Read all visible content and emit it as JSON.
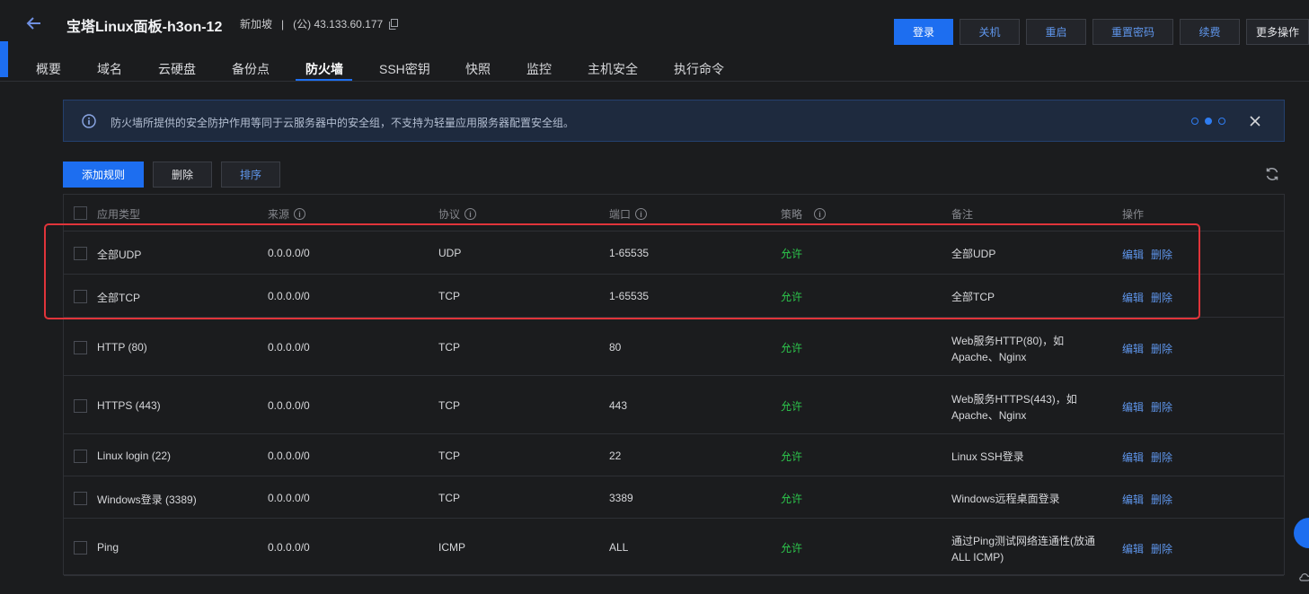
{
  "header": {
    "title": "宝塔Linux面板-h3on-12",
    "region": "新加坡",
    "separator": "|",
    "ip": "(公) 43.133.60.177",
    "buttons": {
      "login": "登录",
      "shutdown": "关机",
      "restart": "重启",
      "reset_password": "重置密码",
      "renew": "续费",
      "more": "更多操作"
    }
  },
  "tabs": [
    "概要",
    "域名",
    "云硬盘",
    "备份点",
    "防火墙",
    "SSH密钥",
    "快照",
    "监控",
    "主机安全",
    "执行命令"
  ],
  "active_tab": "防火墙",
  "notice": {
    "text": "防火墙所提供的安全防护作用等同于云服务器中的安全组，不支持为轻量应用服务器配置安全组。"
  },
  "actions": {
    "add_rule": "添加规则",
    "delete": "删除",
    "sort": "排序"
  },
  "table": {
    "headers": {
      "type": "应用类型",
      "source": "来源",
      "protocol": "协议",
      "port": "端口",
      "policy": "策略",
      "note": "备注",
      "ops": "操作"
    },
    "edit_label": "编辑",
    "delete_label": "删除",
    "rows": [
      {
        "type": "全部UDP",
        "source": "0.0.0.0/0",
        "protocol": "UDP",
        "port": "1-65535",
        "policy": "允许",
        "note": "全部UDP"
      },
      {
        "type": "全部TCP",
        "source": "0.0.0.0/0",
        "protocol": "TCP",
        "port": "1-65535",
        "policy": "允许",
        "note": "全部TCP"
      },
      {
        "type": "HTTP (80)",
        "source": "0.0.0.0/0",
        "protocol": "TCP",
        "port": "80",
        "policy": "允许",
        "note": "Web服务HTTP(80)，如Apache、Nginx"
      },
      {
        "type": "HTTPS (443)",
        "source": "0.0.0.0/0",
        "protocol": "TCP",
        "port": "443",
        "policy": "允许",
        "note": "Web服务HTTPS(443)，如Apache、Nginx"
      },
      {
        "type": "Linux login (22)",
        "source": "0.0.0.0/0",
        "protocol": "TCP",
        "port": "22",
        "policy": "允许",
        "note": "Linux SSH登录"
      },
      {
        "type": "Windows登录 (3389)",
        "source": "0.0.0.0/0",
        "protocol": "TCP",
        "port": "3389",
        "policy": "允许",
        "note": "Windows远程桌面登录"
      },
      {
        "type": "Ping",
        "source": "0.0.0.0/0",
        "protocol": "ICMP",
        "port": "ALL",
        "policy": "允许",
        "note": "通过Ping测试网络连通性(放通ALL ICMP)"
      }
    ]
  },
  "colors": {
    "background": "#1b1c1e",
    "primary": "#1d6ef0",
    "link": "#5f96ec",
    "allow": "#2dc84c",
    "highlight": "#e0343a"
  }
}
